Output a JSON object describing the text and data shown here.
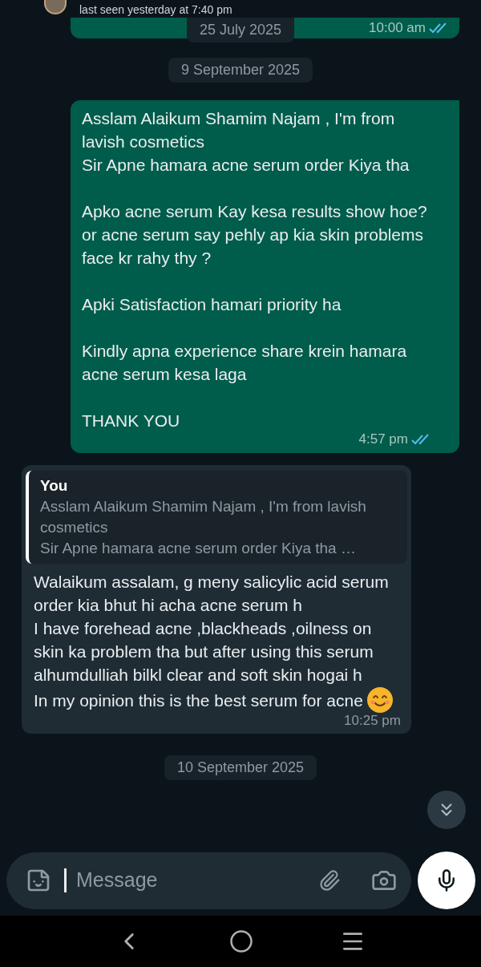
{
  "header": {
    "status": "last seen yesterday at 7:40 pm"
  },
  "sticky_date": "25 July 2025",
  "messages": [
    {
      "kind": "outgoing",
      "time": "10:00 am",
      "read": true
    },
    {
      "kind": "date",
      "text": "9 September 2025"
    },
    {
      "kind": "outgoing",
      "text": "Asslam Alaikum Shamim Najam , I'm from lavish cosmetics\nSir Apne hamara acne serum order Kiya tha\n\nApko acne serum Kay kesa results show hoe? or acne serum say pehly ap kia skin problems face kr rahy thy ?\n\nApki Satisfaction hamari priority ha\n\nKindly apna experience share krein hamara acne serum kesa laga\n\nTHANK YOU",
      "time": "4:57 pm",
      "read": true
    },
    {
      "kind": "incoming",
      "quote": {
        "author": "You",
        "text": "Asslam Alaikum Shamim Najam , I'm from lavish cosmetics\nSir Apne hamara acne serum order Kiya tha …"
      },
      "paragraphs": [
        "Walaikum assalam, g meny salicylic acid serum order kia bhut hi acha acne serum h",
        "I have forehead acne ,blackheads ,oilness on skin ka problem tha but after using this serum alhumdulliah bilkl clear and soft skin hogai h",
        "In my opinion this is the best serum for acne"
      ],
      "emoji": true,
      "time": "10:25 pm"
    },
    {
      "kind": "date",
      "text": "10 September 2025"
    }
  ],
  "composer": {
    "placeholder": "Message"
  }
}
